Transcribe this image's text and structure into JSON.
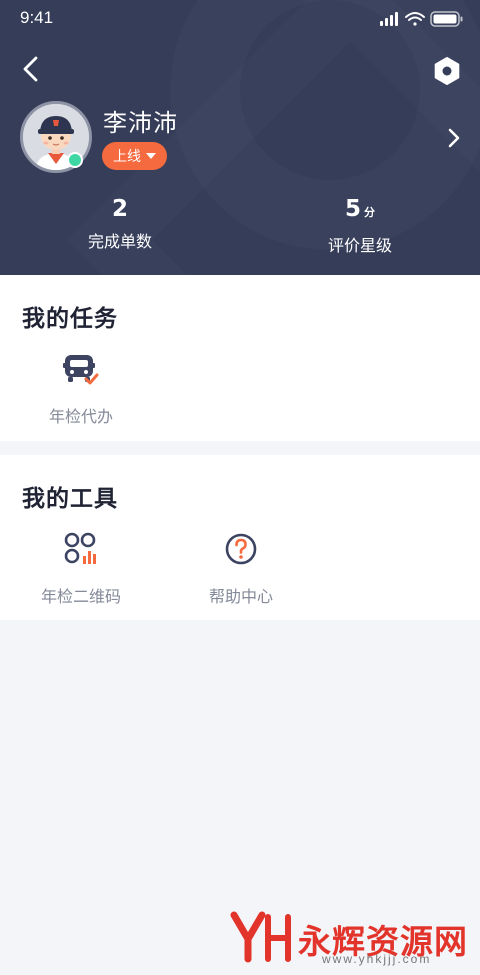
{
  "status_bar": {
    "time": "9:41"
  },
  "profile": {
    "name": "李沛沛",
    "status_label": "上线"
  },
  "stats": [
    {
      "value": "2",
      "unit": "",
      "label": "完成单数"
    },
    {
      "value": "5",
      "unit": "分",
      "label": "评价星级"
    }
  ],
  "tasks": {
    "title": "我的任务",
    "items": [
      {
        "label": "年检代办",
        "icon": "car-check-icon"
      }
    ]
  },
  "tools": {
    "title": "我的工具",
    "items": [
      {
        "label": "年检二维码",
        "icon": "qrcode-chart-icon"
      },
      {
        "label": "帮助中心",
        "icon": "help-circle-icon"
      }
    ]
  },
  "watermark": {
    "text": "永辉资源网",
    "url": "www.yhkjjj.com"
  },
  "colors": {
    "header_bg": "#353d59",
    "accent": "#f56a3f",
    "online": "#3fd8a5"
  }
}
